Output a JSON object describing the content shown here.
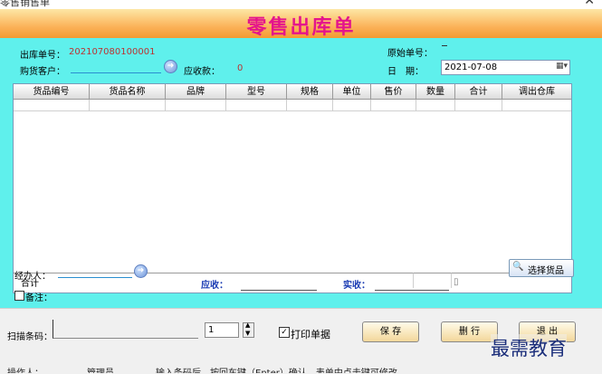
{
  "window": {
    "title": "零售销售单"
  },
  "banner": {
    "title": "零售出库单"
  },
  "form": {
    "order_no_label": "出库单号：",
    "order_no_value": "202107080100001",
    "orig_no_label": "原始单号：",
    "orig_no_value": "",
    "customer_label": "购货客户：",
    "receivable_label": "应收款：",
    "receivable_value": "0",
    "date_label": "日　期：",
    "date_value": "2021-07-08"
  },
  "table": {
    "columns": [
      "货品编号",
      "货品名称",
      "品牌",
      "型号",
      "规格",
      "单位",
      "售价",
      "数量",
      "合计",
      "调出仓库"
    ],
    "total_label": "合计"
  },
  "footer": {
    "handler_label": "经办人：",
    "choose_goods_label": "选择货品",
    "yingshou_label": "应收：",
    "shishou_label": "实收：",
    "note_label": "备注："
  },
  "bottom": {
    "scan_label": "扫描条码：",
    "qty_value": "1",
    "print_label": "打印单据",
    "save_label": "保 存",
    "delete_label": "删 行",
    "exit_label": "退 出"
  },
  "status": {
    "operator_label": "操作人：",
    "operator_value": "管理员",
    "hint": "输入条码后，按回车键（Enter）确认，表单中点击键可修改"
  },
  "watermark": {
    "text": "最需教育"
  }
}
